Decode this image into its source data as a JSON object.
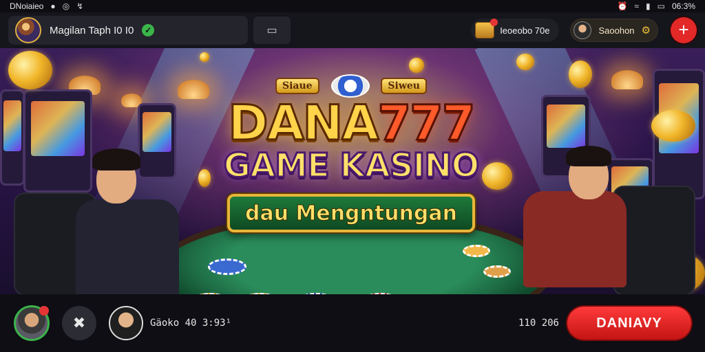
{
  "status_bar": {
    "app_label": "DNoiaieo",
    "time": "06:3%",
    "icons": [
      "camera-icon",
      "instagram-icon",
      "usb-icon",
      "alarm-icon",
      "wifi-icon",
      "signal-icon",
      "battery-icon"
    ]
  },
  "header": {
    "profile_name": "Magilan Taph I0 I0",
    "verified_icon": "check-badge-icon",
    "cast_icon": "cast-icon",
    "balance_label": "Ieoeobo 70e",
    "session_label": "Saoohon",
    "add_icon": "plus-icon"
  },
  "hero": {
    "sign_left": "Siaue",
    "sign_right": "Siweu",
    "title_dana": "DANA",
    "title_777": "777",
    "subtitle": "GAME KASINO",
    "tagline": "dau Mengntungan"
  },
  "footer": {
    "tool_icon": "wrench-icon",
    "chat_text": "Gäoko 40 3:93¹",
    "count_text": "110 206",
    "cta_label": "DANIAVY"
  },
  "colors": {
    "accent_red": "#e32828",
    "gold": "#ffd34a",
    "verified_green": "#3bb54a"
  }
}
